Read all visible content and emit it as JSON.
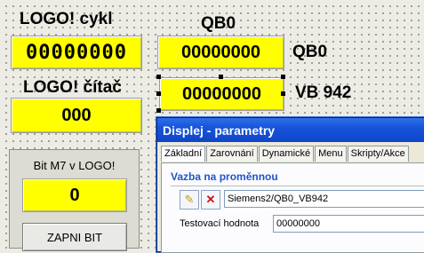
{
  "labels": {
    "logo_cyklus": "LOGO! cykl",
    "logo_citac": "LOGO! čítač",
    "qb0_top": "QB0",
    "qb0_right": "QB0",
    "vb942_right": "VB 942"
  },
  "displays": {
    "cyklus_value": "00000000",
    "citac_value": "000",
    "qb0_value": "00000000",
    "vb942_value": "00000000"
  },
  "bit_panel": {
    "title": "Bit M7 v LOGO!",
    "value": "0",
    "button_label": "ZAPNI BIT"
  },
  "dialog": {
    "title": "Displej - parametry",
    "tabs": [
      "Základní",
      "Zarovnání",
      "Dynamické",
      "Menu",
      "Skripty/Akce"
    ],
    "active_tab": "Základní",
    "section_title": "Vazba na proměnnou",
    "variable_path": "Siemens2/QB0_VB942",
    "test_value_label": "Testovací hodnota",
    "test_value": "00000000"
  },
  "colors": {
    "display_yellow": "#ffff00",
    "dialog_title_blue": "#1653d9",
    "section_blue": "#2155c8",
    "delete_red": "#d01010"
  },
  "icons": {
    "edit_button": "pencil-icon",
    "delete_button": "close-icon"
  }
}
